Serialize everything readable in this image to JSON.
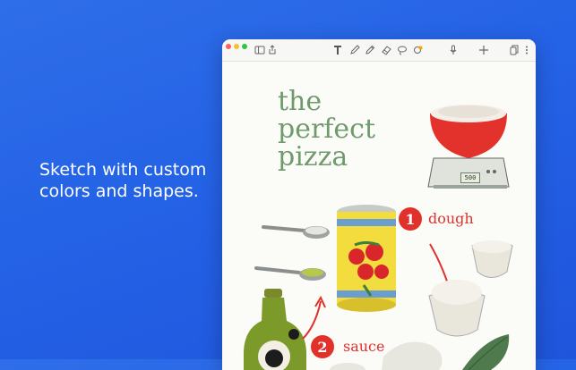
{
  "headline": {
    "line1": "Sketch with custom",
    "line2": "colors and shapes."
  },
  "window": {
    "traffic_lights": [
      "#fe5f57",
      "#febc2e",
      "#28c840"
    ],
    "toolbar_icons": [
      "sidebar-icon",
      "share-icon",
      "text-tool-icon",
      "pen-tool-icon",
      "pencil-tool-icon",
      "eraser-tool-icon",
      "lasso-tool-icon",
      "shapes-tool-icon",
      "microphone-icon",
      "add-icon",
      "copy-icon",
      "more-icon"
    ],
    "accent": "#ff9f0a"
  },
  "note": {
    "title_lines": [
      "the",
      "perfect",
      "pizza"
    ],
    "title_color": "#6f9a6c",
    "scale_readout": "500",
    "steps": [
      {
        "number": "1",
        "label": "dough"
      },
      {
        "number": "2",
        "label": "sauce"
      }
    ],
    "step_color": "#e0322b"
  }
}
